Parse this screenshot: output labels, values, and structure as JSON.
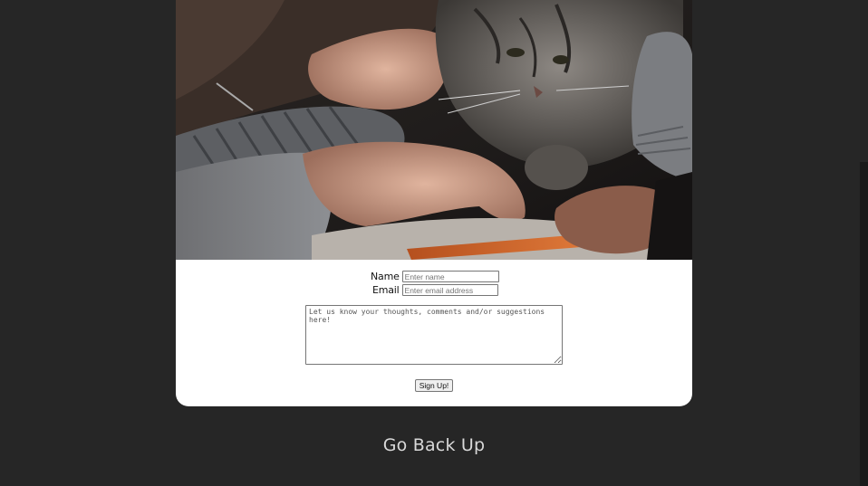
{
  "form": {
    "name_label": "Name",
    "name_placeholder": "Enter name",
    "email_label": "Email",
    "email_placeholder": "Enter email address",
    "message_placeholder": "Let us know your thoughts, comments and/or suggestions here!",
    "submit_label": "Sign Up!"
  },
  "footer": {
    "back_up_link": "Go Back Up"
  },
  "colors": {
    "page_background": "#262626",
    "card_background": "#ffffff",
    "link_color": "#d9d9d9"
  }
}
